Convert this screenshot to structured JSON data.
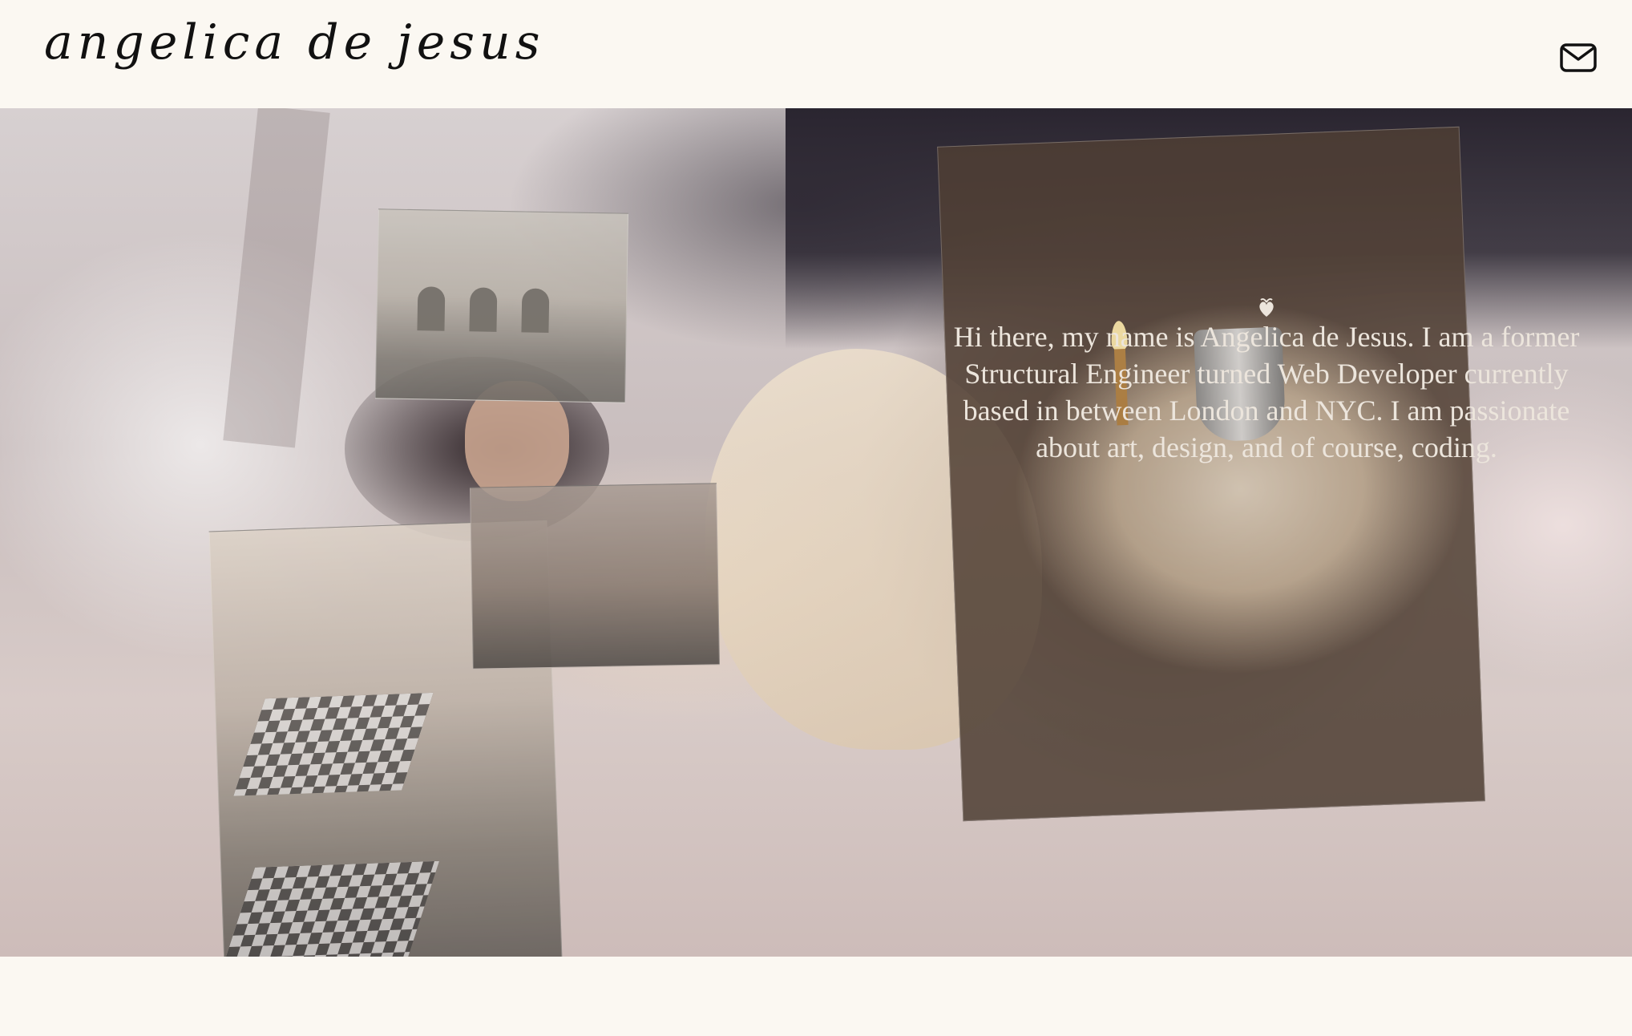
{
  "header": {
    "logo_text": "angelica de jesus",
    "mail_icon": "mail-icon"
  },
  "about": {
    "icon": "flourish-icon",
    "text": "Hi there, my name is Angelica de Jesus. I am a former Structural Engineer turned Web Developer currently based in between London and NYC. I am passionate about art, design, and of course, coding."
  },
  "colors": {
    "page_background": "#fbf8f2",
    "logo": "#111111",
    "about_text": "#ece5dc"
  }
}
